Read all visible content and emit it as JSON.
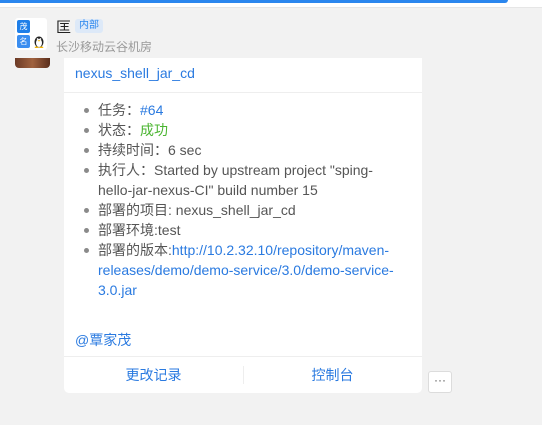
{
  "header": {
    "group_name": "匡",
    "tag": "内部",
    "subtitle": "长沙移动云谷机房",
    "avatar_chars": [
      "茂",
      "名"
    ]
  },
  "card": {
    "title": "nexus_shell_jar_cd",
    "items": [
      {
        "label": "任务：",
        "value": "#64"
      },
      {
        "label": "状态：",
        "value": "成功"
      },
      {
        "label": "持续时间：",
        "value": "6 sec"
      },
      {
        "label": "执行人：",
        "value": "Started by upstream project \"sping-hello-jar-nexus-CI\" build number 15"
      },
      {
        "label": "部署的项目: ",
        "value": "nexus_shell_jar_cd"
      },
      {
        "label": "部署环境:",
        "value": "test"
      },
      {
        "label": "部署的版本:",
        "value": "http://10.2.32.10/repository/maven-releases/demo/demo-service/3.0/demo-service-3.0.jar"
      }
    ],
    "mention": "@覃家茂",
    "actions": [
      "更改记录",
      "控制台"
    ]
  },
  "more_button": "···",
  "colors": {
    "accent": "#2a86ee",
    "link": "#2a7ae0",
    "success": "#4bb531"
  }
}
